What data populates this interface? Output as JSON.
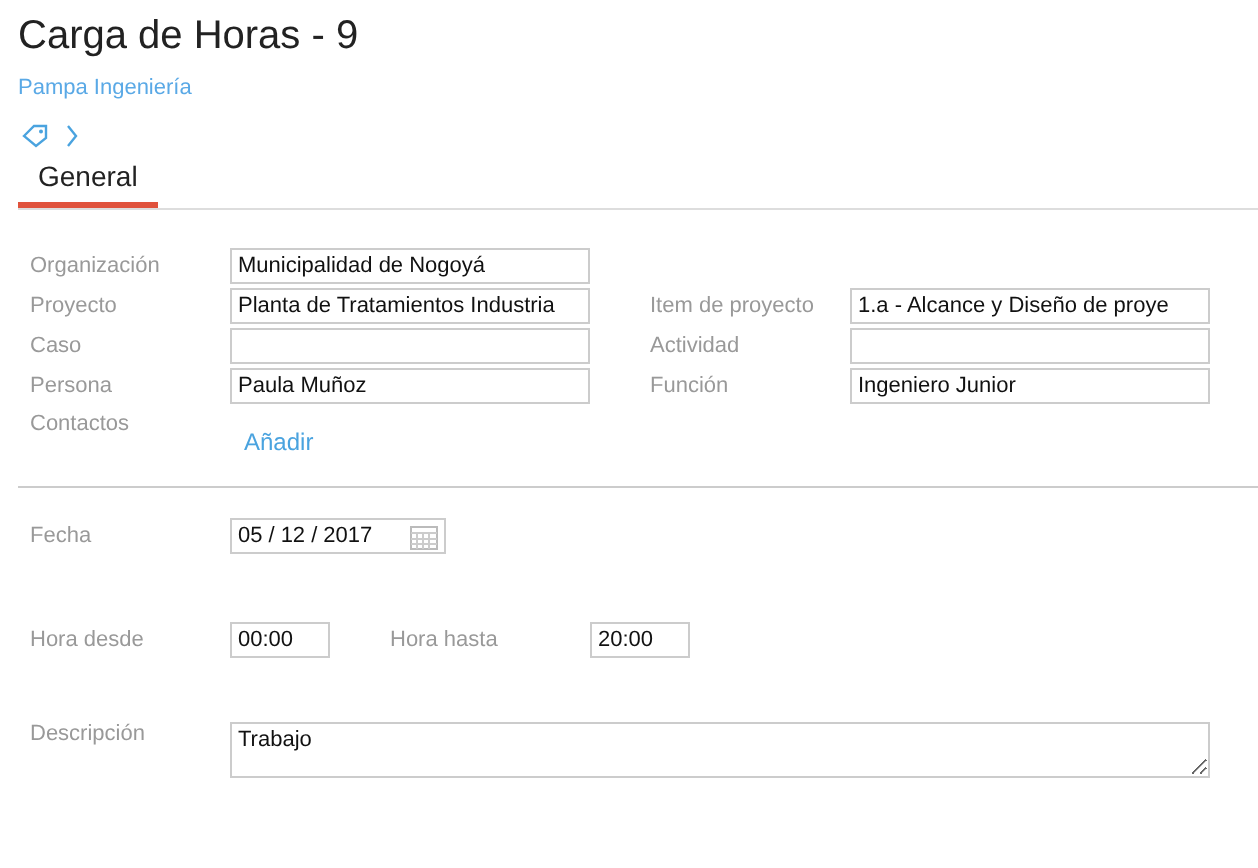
{
  "header": {
    "title": "Carga de Horas - 9",
    "subtitle": "Pampa Ingeniería"
  },
  "tabs": [
    {
      "label": "General",
      "selected": true
    }
  ],
  "fields": [
    {
      "label": "Organización",
      "value": "Municipalidad de Nogoyá"
    },
    {
      "label": "Proyecto",
      "value": "Planta de Tratamientos Industria",
      "right_label": "Item de proyecto",
      "right_value": "1.a - Alcance y Diseño de proye"
    },
    {
      "label": "Caso",
      "right_label": "Actividad"
    },
    {
      "label": "Persona",
      "value": "Paula Muñoz",
      "right_label": "Función",
      "right_value": "Ingeniero Junior"
    }
  ],
  "contacts": {
    "label": "Contactos",
    "link": "Añadir"
  },
  "date": {
    "label": "Fecha",
    "parts": [
      "05",
      "/",
      "12",
      "/",
      "2017"
    ]
  },
  "hours": {
    "from_label": "Hora desde",
    "from": "00:00",
    "to_label": "Hora hasta",
    "to": "20:00"
  },
  "description": {
    "label": "Descripción",
    "value": "Trabajo"
  }
}
